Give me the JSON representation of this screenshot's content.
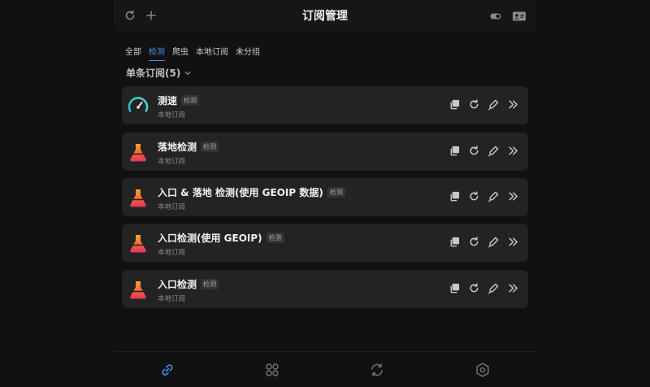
{
  "header": {
    "title": "订阅管理",
    "left_icons": [
      "refresh-icon",
      "add-icon"
    ],
    "right_icons": [
      "toggle-icon",
      "id-card-icon"
    ]
  },
  "tabs": [
    {
      "label": "全部",
      "active": false
    },
    {
      "label": "检测",
      "active": true
    },
    {
      "label": "爬虫",
      "active": false
    },
    {
      "label": "本地订阅",
      "active": false
    },
    {
      "label": "未分组",
      "active": false
    }
  ],
  "group": {
    "label": "单条订阅(5)",
    "icon": "chevron-down-icon"
  },
  "items": [
    {
      "name": "测速",
      "badge": "检测",
      "subtitle": "本地订阅",
      "icon": "speedometer-icon"
    },
    {
      "name": "落地检测",
      "badge": "检测",
      "subtitle": "本地订阅",
      "icon": "flask-icon"
    },
    {
      "name": "入口 & 落地 检测(使用 GEOIP 数据)",
      "badge": "检测",
      "subtitle": "本地订阅",
      "icon": "flask-icon"
    },
    {
      "name": "入口检测(使用 GEOIP)",
      "badge": "检测",
      "subtitle": "本地订阅",
      "icon": "flask-icon"
    },
    {
      "name": "入口检测",
      "badge": "检测",
      "subtitle": "本地订阅",
      "icon": "flask-icon"
    }
  ],
  "item_actions": [
    "copy-icon",
    "refresh-icon",
    "edit-icon",
    "forward-icon"
  ],
  "bottom_nav": [
    {
      "icon": "link-icon",
      "active": true
    },
    {
      "icon": "grid-icon",
      "active": false
    },
    {
      "icon": "sync-icon",
      "active": false
    },
    {
      "icon": "settings-icon",
      "active": false
    }
  ],
  "colors": {
    "background": "#111111",
    "card": "#232323",
    "accent": "#4f8ff0",
    "gauge": "#3ec6d8",
    "flask_top": "#f5a623",
    "flask_bottom": "#e8325a"
  }
}
